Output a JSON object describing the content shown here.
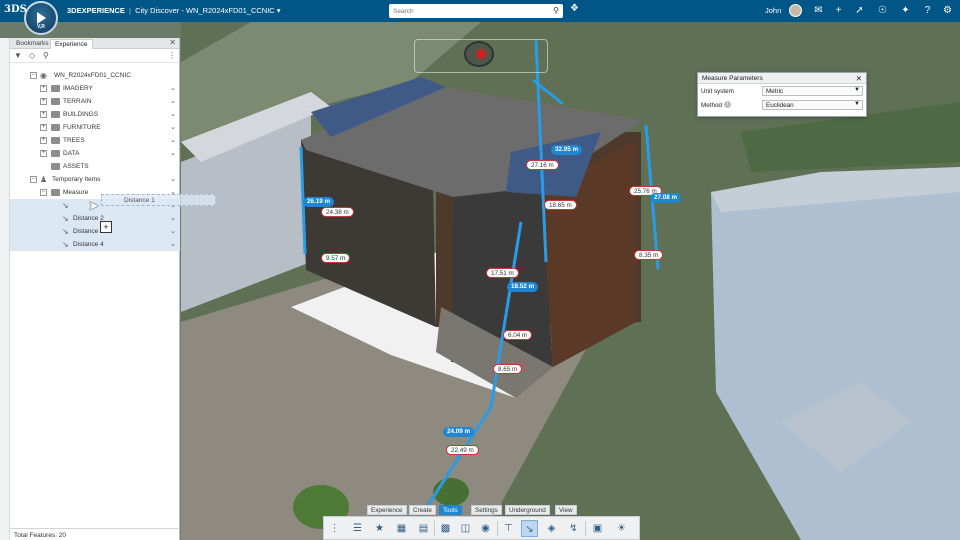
{
  "topbar": {
    "logo": "3DS",
    "compass_label": "V,R",
    "brand": "3DEXPERIENCE",
    "separator": "|",
    "app_title": "City Discover - WN_R2024xFD01_CCNIC",
    "search_placeholder": "Search",
    "user_name": "John",
    "icons": [
      "tag-icon",
      "chat-icon",
      "add-icon",
      "share-icon",
      "network-icon",
      "tools-icon",
      "help-icon",
      "settings-icon"
    ]
  },
  "panel": {
    "tabs": [
      "Bookmarks",
      "Experience"
    ],
    "active_tab": "Experience",
    "tree": {
      "root": "WN_R2024xFD01_CCNIC",
      "layers": [
        "IMAGERY",
        "TERRAIN",
        "BUILDINGS",
        "FURNITURE",
        "TREES",
        "DATA",
        "ASSETS"
      ],
      "temporary": "Temporary Items",
      "measure": "Measure",
      "distances": [
        "Distance 2",
        "Distance 3",
        "Distance 4"
      ]
    },
    "drag_item": "Distance 1",
    "footer": "Total Features: 20"
  },
  "measure_dialog": {
    "title": "Measure Parameters",
    "unit_label": "Unit system",
    "unit_value": "Metric",
    "method_label": "Method",
    "method_value": "Euclidean"
  },
  "measurements": {
    "blue": [
      "26.19 m",
      "32.95 m",
      "27.08 m",
      "18.52 m",
      "24.09 m"
    ],
    "white": [
      "24.38 m",
      "27.16 m",
      "18.65 m",
      "25.76 m",
      "8.35 m",
      "9.57 m",
      "17.51 m",
      "6.04 m",
      "8.65 m",
      "22.49 m"
    ]
  },
  "actionbar": {
    "sections": [
      "Experience",
      "Create",
      "Tools",
      "Settings",
      "Underground",
      "View"
    ],
    "active_section": "Tools"
  },
  "colors": {
    "header": "#005686",
    "accent": "#1f86d2",
    "measure_line": "#2a9be6"
  }
}
